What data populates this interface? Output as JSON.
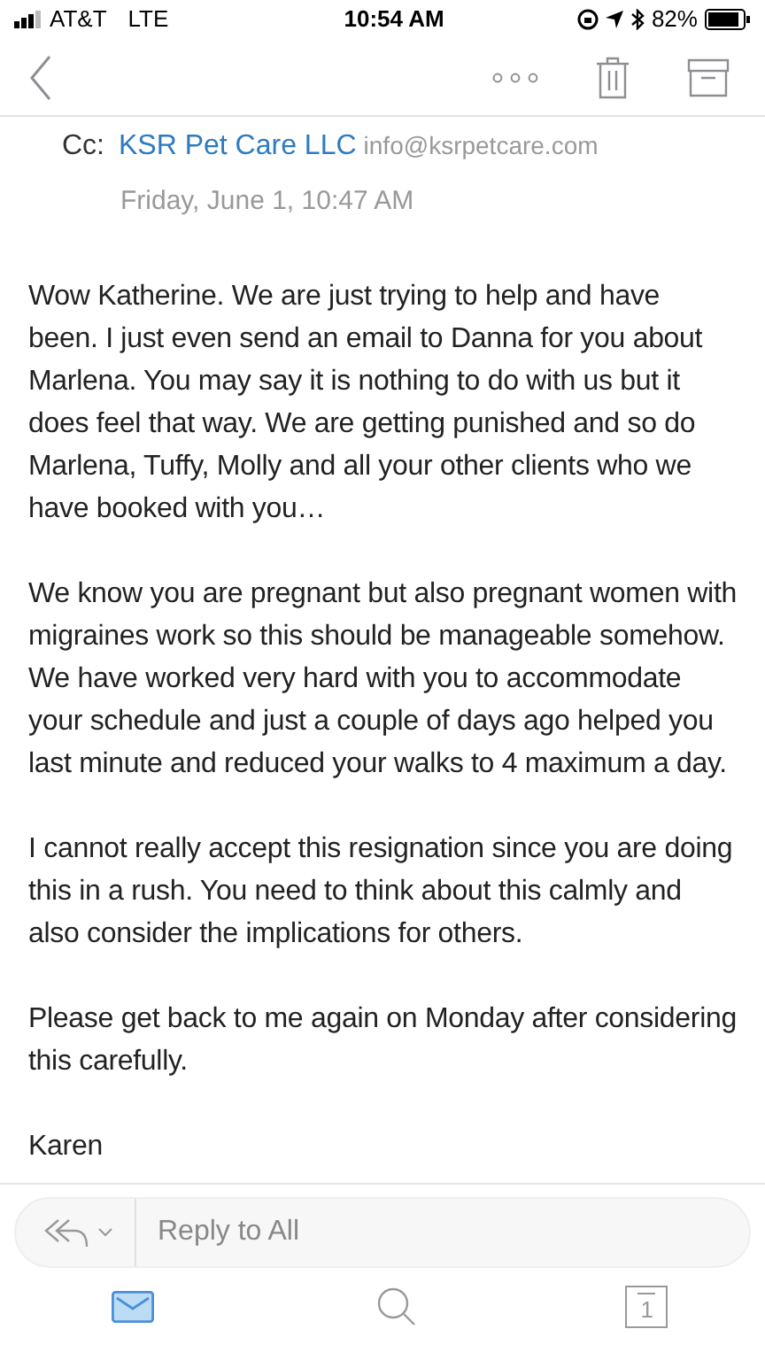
{
  "status_bar": {
    "carrier": "AT&T",
    "network": "LTE",
    "time": "10:54 AM",
    "battery": "82%"
  },
  "header": {
    "cc_label": "Cc:",
    "cc_name": "KSR Pet Care LLC",
    "cc_email": "info@ksrpetcare.com",
    "date": "Friday, June 1, 10:47 AM"
  },
  "body": [
    "Wow Katherine. We are just trying to help and have been. I just even send an email to Danna for you about Marlena. You may say it is nothing to do with us but it does feel that way. We are getting punished and so do Marlena, Tuffy, Molly and all your other clients who we have booked with you…",
    "We know you are pregnant but also pregnant women with migraines work so this should be manageable somehow. We have worked very hard with you to accommodate your schedule and just a couple of days ago helped you last minute and reduced your walks to 4 maximum a day.",
    "I cannot really accept this resignation since you are doing this in a rush. You need to think about this calmly and also consider the implications for others.",
    "Please get back to me again on Monday after considering this carefully.",
    "Karen"
  ],
  "reply": {
    "placeholder": "Reply to All"
  },
  "tabs": [
    {
      "kind": "mail",
      "selected": true
    },
    {
      "kind": "search",
      "selected": false
    },
    {
      "kind": "calendar",
      "label": "1",
      "selected": false
    }
  ]
}
